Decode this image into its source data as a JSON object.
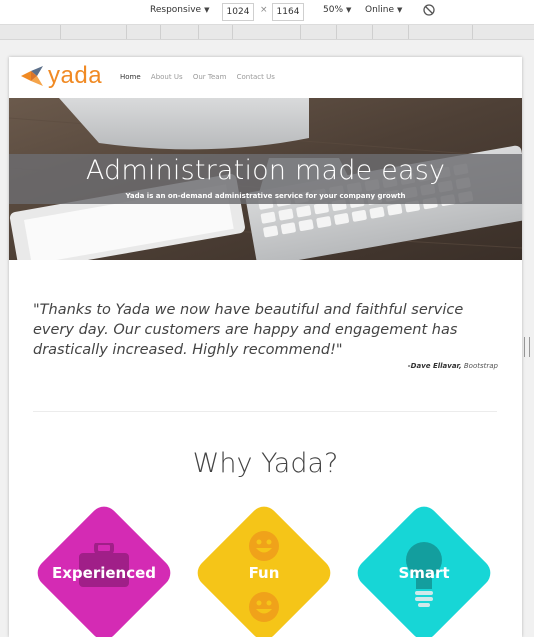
{
  "devtools": {
    "device": "Responsive",
    "width": "1024",
    "height": "1164",
    "times": "×",
    "zoom": "50%",
    "network": "Online",
    "rotate_icon": "rotate-icon"
  },
  "site": {
    "logo_text": "yada",
    "nav": [
      "Home",
      "About Us",
      "Our Team",
      "Contact Us"
    ],
    "colors": {
      "brand_orange": "#f08a24",
      "magenta": "#d42bb4",
      "yellow": "#f5c518",
      "cyan": "#17d6d6"
    }
  },
  "hero": {
    "title": "Administration made easy",
    "subtitle": "Yada is an on-demand administrative service for your company growth"
  },
  "testimonial": {
    "quote": "\"Thanks to Yada we now have beautiful and faithful service every day. Our customers are happy and engagement has drastically increased. Highly recommend!\"",
    "author": "-Dave Ellavar,",
    "company": "Bootstrap"
  },
  "why": {
    "heading": "Why Yada?",
    "features": [
      {
        "label": "Experienced",
        "icon": "briefcase-icon"
      },
      {
        "label": "Fun",
        "icon": "smiley-icon"
      },
      {
        "label": "Smart",
        "icon": "lightbulb-icon"
      }
    ]
  }
}
